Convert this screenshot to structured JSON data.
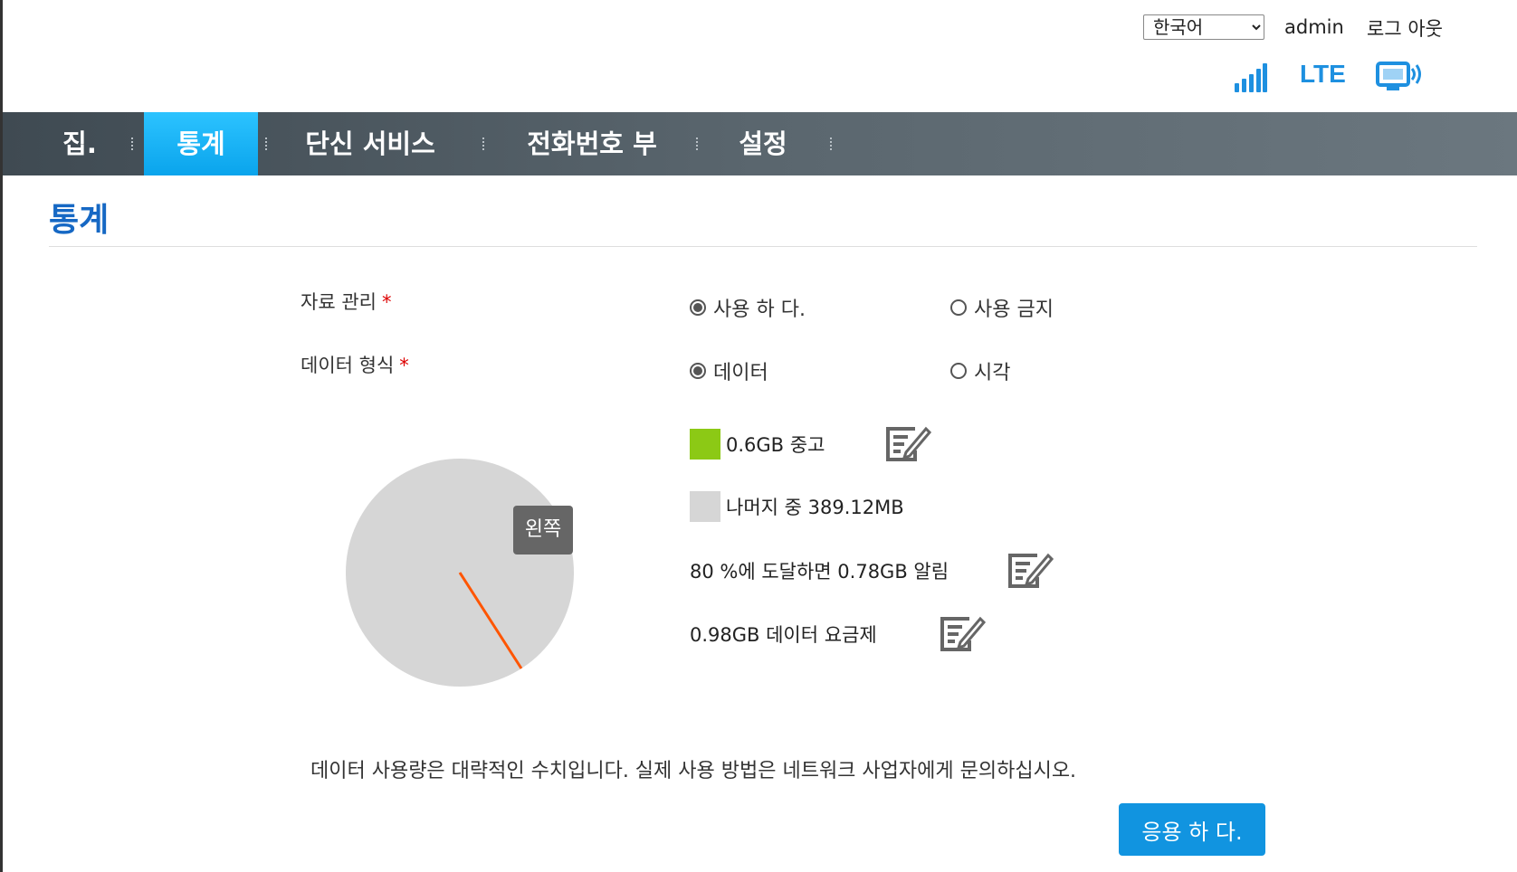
{
  "header": {
    "language_selected": "한국어",
    "language_options": [
      "한국어"
    ],
    "user": "admin",
    "logout_label": "로그 아웃",
    "network_type": "LTE"
  },
  "nav": {
    "items": [
      {
        "label": "집.",
        "active": false
      },
      {
        "label": "통계",
        "active": true
      },
      {
        "label": "단신 서비스",
        "active": false
      },
      {
        "label": "전화번호 부",
        "active": false
      },
      {
        "label": "설정",
        "active": false
      }
    ]
  },
  "page": {
    "title": "통계",
    "data_management": {
      "label": "자료 관리",
      "required_mark": "*",
      "options": [
        {
          "label": "사용 하 다.",
          "checked": true
        },
        {
          "label": "사용 금지",
          "checked": false
        }
      ]
    },
    "data_type": {
      "label": "데이터 형식",
      "required_mark": "*",
      "options": [
        {
          "label": "데이터",
          "checked": true
        },
        {
          "label": "시각",
          "checked": false
        }
      ]
    },
    "legend": {
      "used": {
        "text": "0.6GB 중고",
        "color": "#8cc915"
      },
      "remaining": {
        "text": "나머지 중 389.12MB",
        "color": "#d6d6d6"
      },
      "alert": {
        "text": "80 %에 도달하면 0.78GB 알림"
      },
      "plan": {
        "text": "0.98GB 데이터 요금제"
      }
    },
    "chart_tooltip": "왼쪽",
    "note": "데이터 사용량은 대략적인 수치입니다. 실제 사용 방법은 네트워크 사업자에게 문의하십시오.",
    "apply_label": "응용 하 다."
  },
  "colors": {
    "accent": "#1194e0",
    "nav_active": "#14b2f5",
    "title": "#1668c4",
    "used": "#8cc915",
    "remaining": "#d6d6d6",
    "alert_line": "#ff5500"
  }
}
